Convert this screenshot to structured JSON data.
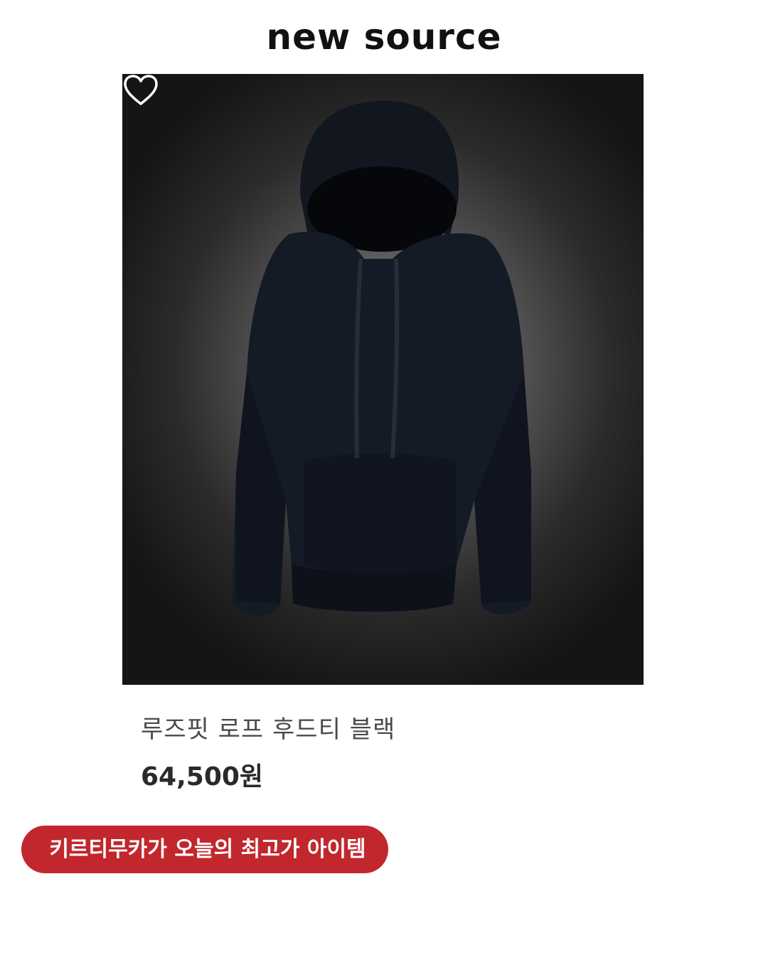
{
  "brand": {
    "logo_text": "new source"
  },
  "product": {
    "name": "루즈핏 로프 후드티 블랙",
    "price": "64,500원",
    "image_icon": "hoodie-photo",
    "wishlist_icon": "heart-outline-icon"
  },
  "promo": {
    "label": "키르티무카가 오늘의 최고가 아이템",
    "color": "#c1272d"
  }
}
